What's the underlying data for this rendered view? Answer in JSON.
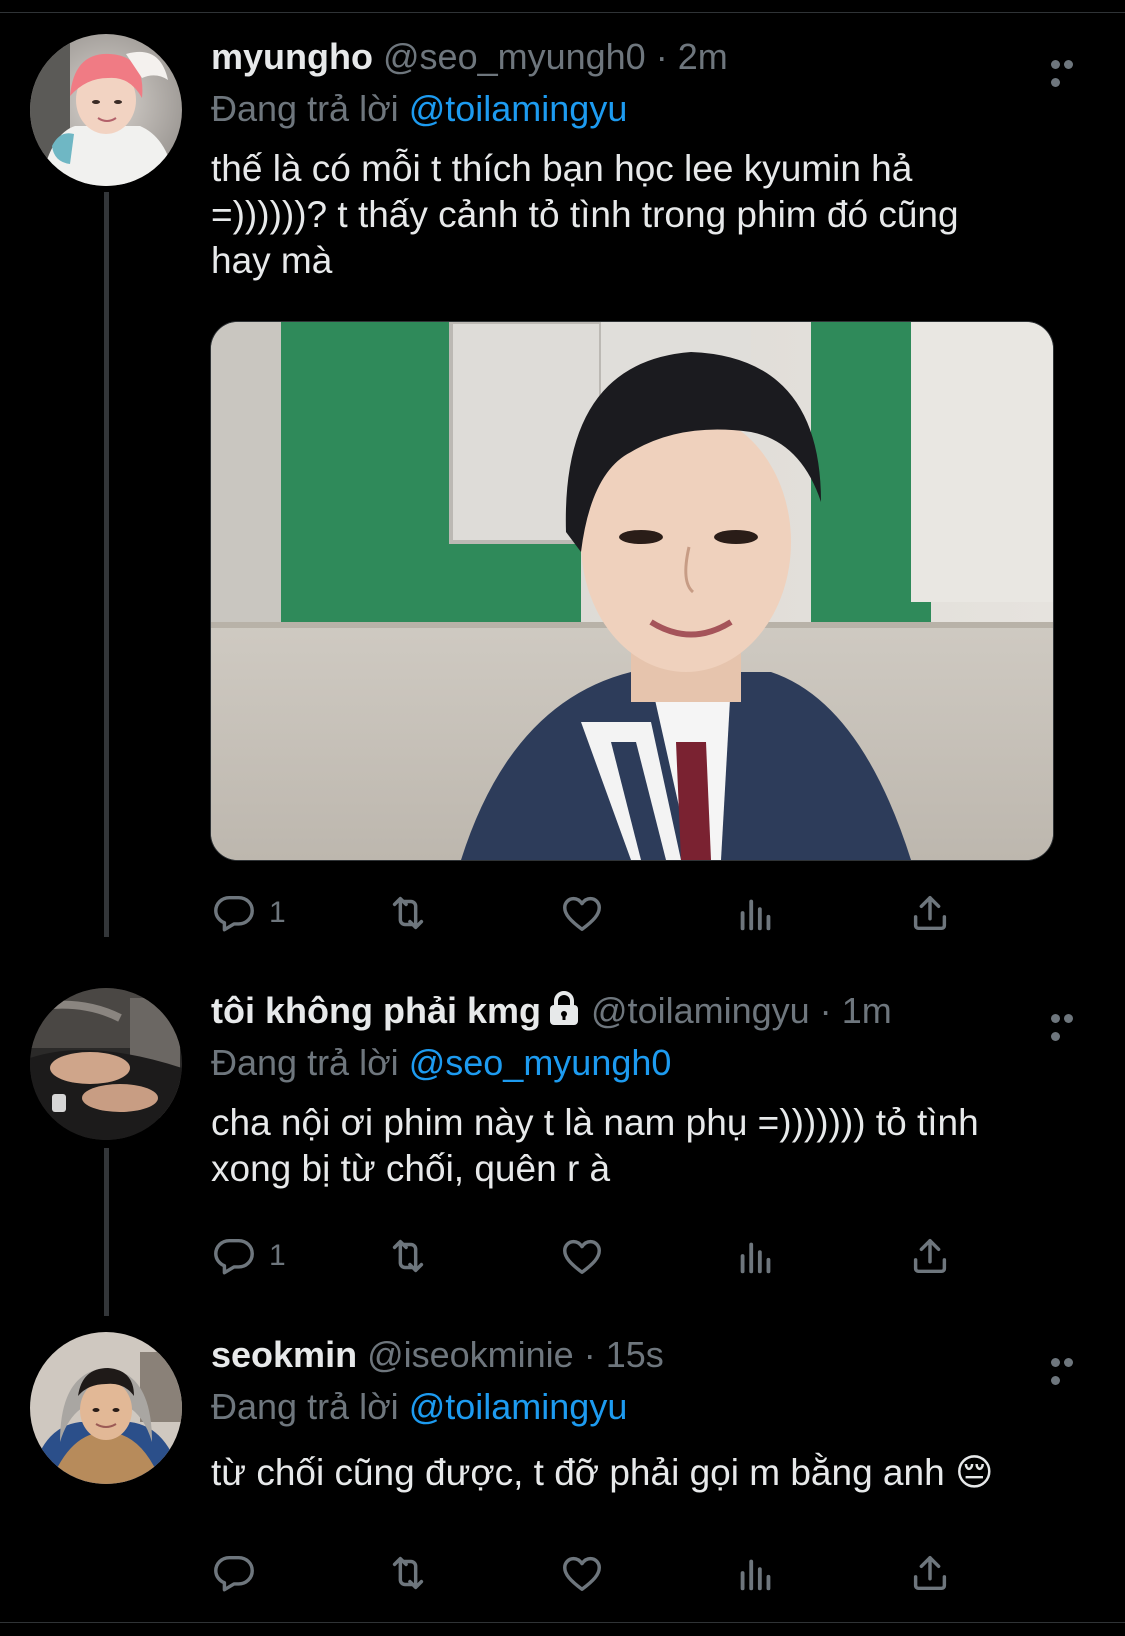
{
  "colors": {
    "background": "#000000",
    "text": "#e7e9ea",
    "muted": "#6e767d",
    "accent": "#1d9bf0",
    "thread_line": "#333639"
  },
  "tweets": [
    {
      "name": "myungho",
      "handle": "@seo_myungh0",
      "separator": "·",
      "time": "2m",
      "replying_prefix": "Đang trả lời",
      "replying_to": "@toilamingyu",
      "text": "thế là có mỗi t thích bạn học lee kyumin hả\n=))))))? t thấy cảnh tỏ tình trong phim đó cũng\nhay mà",
      "has_media": true,
      "reply_count": "1",
      "avatar_icon": "avatar-photo-pink-hair"
    },
    {
      "name": "tôi không phải kmg",
      "protected": true,
      "handle": "@toilamingyu",
      "separator": "·",
      "time": "1m",
      "replying_prefix": "Đang trả lời",
      "replying_to": "@seo_myungh0",
      "text": "cha nội ơi phim này t là nam phụ =))))))) tỏ tình\nxong bị từ chối, quên r à",
      "reply_count": "1",
      "avatar_icon": "avatar-photo-hands"
    },
    {
      "name": "seokmin",
      "handle": "@iseokminie",
      "separator": "·",
      "time": "15s",
      "replying_prefix": "Đang trả lời",
      "replying_to": "@toilamingyu",
      "text": "từ chối cũng được, t đỡ phải gọi m bằng anh 😔",
      "reply_count": "",
      "avatar_icon": "avatar-photo-hoodie"
    }
  ]
}
